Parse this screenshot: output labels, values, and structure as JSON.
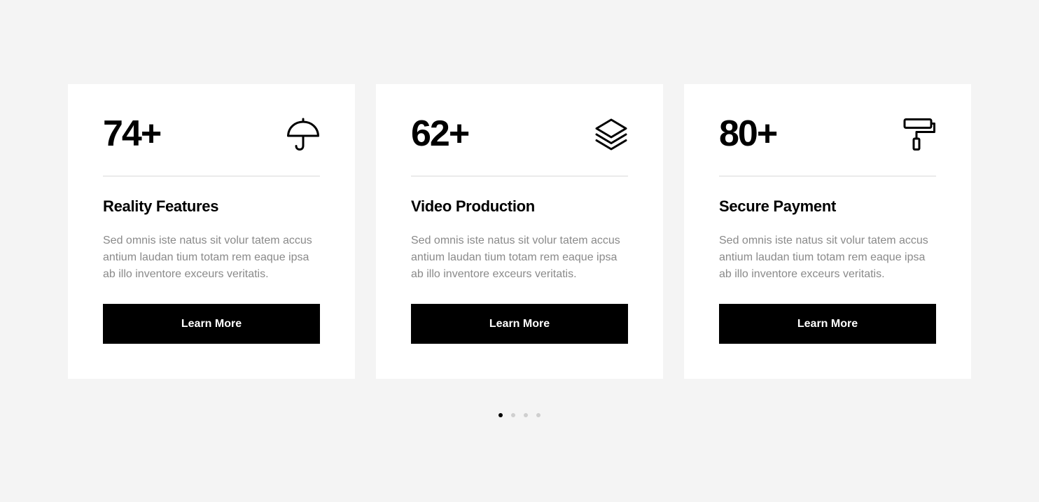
{
  "cards": [
    {
      "number": "74+",
      "icon": "umbrella-icon",
      "title": "Reality Features",
      "description": "Sed omnis iste natus sit volur tatem accus antium laudan tium totam rem eaque ipsa ab illo inventore exceurs veritatis.",
      "button_label": "Learn More"
    },
    {
      "number": "62+",
      "icon": "layers-icon",
      "title": "Video Production",
      "description": "Sed omnis iste natus sit volur tatem accus antium laudan tium totam rem eaque ipsa ab illo inventore exceurs veritatis.",
      "button_label": "Learn More"
    },
    {
      "number": "80+",
      "icon": "paint-roller-icon",
      "title": "Secure Payment",
      "description": "Sed omnis iste natus sit volur tatem accus antium laudan tium totam rem eaque ipsa ab illo inventore exceurs veritatis.",
      "button_label": "Learn More"
    }
  ],
  "pagination": {
    "total": 4,
    "active_index": 0
  },
  "colors": {
    "background": "#f4f4f4",
    "card": "#ffffff",
    "accent": "#000000",
    "muted_text": "#8a8a8a",
    "divider": "#d9d9d9"
  }
}
